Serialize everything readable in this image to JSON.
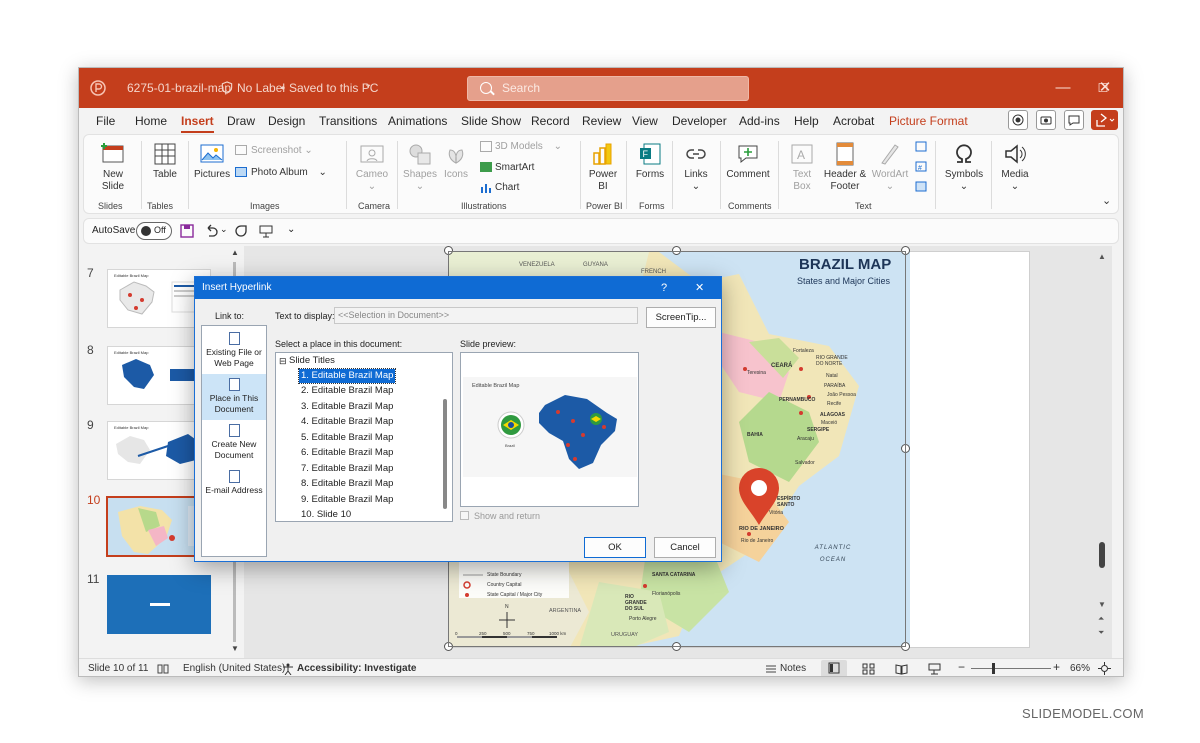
{
  "titlebar": {
    "filename": "6275-01-brazil-map",
    "label_status": "No Label",
    "save_status": "Saved to this PC",
    "search_placeholder": "Search"
  },
  "tabs": [
    "File",
    "Home",
    "Insert",
    "Draw",
    "Design",
    "Transitions",
    "Animations",
    "Slide Show",
    "Record",
    "Review",
    "View",
    "Developer",
    "Add-ins",
    "Help",
    "Acrobat",
    "Picture Format"
  ],
  "ribbon": {
    "new_slide": "New Slide",
    "table": "Table",
    "pictures": "Pictures",
    "screenshot": "Screenshot",
    "photo_album": "Photo Album",
    "cameo": "Cameo",
    "shapes": "Shapes",
    "icons": "Icons",
    "models_3d": "3D Models",
    "smartart": "SmartArt",
    "chart": "Chart",
    "power_bi": "Power BI",
    "forms": "Forms",
    "links": "Links",
    "comment": "Comment",
    "text_box": "Text Box",
    "header_footer": "Header & Footer",
    "wordart": "WordArt",
    "symbols": "Symbols",
    "media": "Media",
    "groups": {
      "slides": "Slides",
      "tables": "Tables",
      "images": "Images",
      "camera": "Camera",
      "illustrations": "Illustrations",
      "power_bi": "Power BI",
      "forms": "Forms",
      "comments": "Comments",
      "text": "Text"
    }
  },
  "qat": {
    "autosave": "AutoSave",
    "toggle": "Off"
  },
  "thumbnails": [
    {
      "num": "7",
      "title": "Editable Brazil Map"
    },
    {
      "num": "8",
      "title": "Editable Brazil Map"
    },
    {
      "num": "9",
      "title": "Editable Brazil Map"
    },
    {
      "num": "10",
      "title": "Editable Brazil Map"
    },
    {
      "num": "11",
      "title": ""
    }
  ],
  "slide": {
    "title": "BRAZIL MAP",
    "subtitle": "States and Major Cities",
    "labels": [
      "VENEZUELA",
      "GUYANA",
      "FRENCH",
      "Fortaleza",
      "RIO GRANDE DO NORTE",
      "Natal",
      "CEARÁ",
      "Teresina",
      "PARAÍBA",
      "João Pessoa",
      "PERNAMBUCO",
      "Recife",
      "ALAGOAS",
      "Maceió",
      "SERGIPE",
      "Aracaju",
      "BAHIA",
      "Salvador",
      "ESPÍRITO SANTO",
      "Vitória",
      "RIO DE JANEIRO",
      "Rio de Janeiro",
      "ATLANTIC OCEAN",
      "SANTA CATARINA",
      "Florianópolis",
      "RIO GRANDE DO SUL",
      "Porto Alegre",
      "ARGENTINA",
      "URUGUAY",
      "State Boundary",
      "Country Capital",
      "State Capital / Major City",
      "0",
      "250",
      "500",
      "750",
      "1000 km",
      "N"
    ]
  },
  "dialog": {
    "title": "Insert Hyperlink",
    "help": "?",
    "close": "✕",
    "link_to": "Link to:",
    "link_options": [
      {
        "label": "Existing File or Web Page",
        "selected": false
      },
      {
        "label": "Place in This Document",
        "selected": true
      },
      {
        "label": "Create New Document",
        "selected": false
      },
      {
        "label": "E-mail Address",
        "selected": false
      }
    ],
    "text_to_display_label": "Text to display:",
    "text_to_display_value": "<<Selection in Document>>",
    "screentip": "ScreenTip...",
    "select_place_label": "Select a place in this document:",
    "tree_root": "Slide Titles",
    "tree_items": [
      "1. Editable Brazil Map",
      "2. Editable Brazil Map",
      "3. Editable Brazil Map",
      "4. Editable Brazil Map",
      "5. Editable Brazil Map",
      "6. Editable Brazil Map",
      "7. Editable Brazil Map",
      "8. Editable Brazil Map",
      "9. Editable Brazil Map",
      "10. Slide 10"
    ],
    "selected_index": 0,
    "slide_preview_label": "Slide preview:",
    "preview_title": "Editable Brazil Map",
    "preview_caption": "Brazil",
    "show_return": "Show and return",
    "ok": "OK",
    "cancel": "Cancel"
  },
  "status": {
    "slide_of": "Slide 10 of 11",
    "language": "English (United States)",
    "accessibility": "Accessibility: Investigate",
    "notes": "Notes",
    "zoom": "66%"
  },
  "credit": "SLIDEMODEL.COM",
  "colors": {
    "accent": "#c43e1c",
    "dialog_blue": "#0f6bd4",
    "selection": "#cce4f7"
  }
}
